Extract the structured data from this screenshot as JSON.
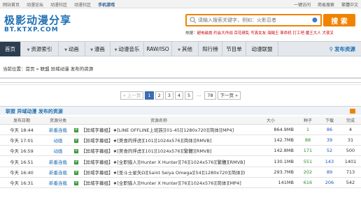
{
  "topbar": {
    "left_links": [
      "网站首页",
      "动漫论坛",
      "动漫社区",
      "动漫社区"
    ],
    "mobile": "手机游戏",
    "right_links": [
      "一键访问",
      "简易搜索",
      "繁體中文"
    ]
  },
  "brand": {
    "logo_cn": "极影动漫分享",
    "logo_en": "BT.KTXP.COM"
  },
  "search": {
    "placeholder": "请输入搜索关键字，例如：火影忍者",
    "button": "搜 索"
  },
  "hot": {
    "label": "热搜：",
    "keywords": "超电磁炮 约会大作战 百花缭乱 写真女友 海贼王 革命机 打工吧 魔王大人 犬夜叉"
  },
  "nav": {
    "items": [
      "首页",
      "资源索引",
      "动画",
      "漫画",
      "动漫音乐",
      "RAW/ISO",
      "其他",
      "阳行榜",
      "节目单",
      "动漫联盟"
    ],
    "publish": "发布资源"
  },
  "crumb": "当前位置：首页 » 联盟 异域动漫 发布的资源",
  "pager": {
    "prev": "« 上一页",
    "pages": [
      "1",
      "2",
      "3",
      "4",
      "5"
    ],
    "ellipsis": "...",
    "last": "78",
    "next": "下一页 »"
  },
  "list_title": "联盟 异域动漫 发布的资源",
  "table": {
    "headers": [
      "发布日期",
      "资源分类",
      "资源名称",
      "大小",
      "种子",
      "下载",
      "完成"
    ],
    "rows": [
      {
        "date": "今天 18:44",
        "cat": "新番连载",
        "name": "【异域字幕组】★[LINE OFFLINE上班族][01-45][1280x720][简体][MP4]",
        "size": "864.9MB",
        "seed": "1",
        "dl": "86",
        "done": "4"
      },
      {
        "date": "今天 17:01",
        "cat": "动画",
        "name": "【异域字幕组】★[美食的俘虏][101][1024x576][简体][RMVB]",
        "size": "142.7MB",
        "seed": "88",
        "dl": "39",
        "done": "31"
      },
      {
        "date": "今天 16:59",
        "cat": "动画",
        "name": "【异域字幕组】★[美食的俘虏][101][1024x576][繁體][RMVB]",
        "size": "142.8MB",
        "seed": "171",
        "dl": "52",
        "done": "500"
      },
      {
        "date": "今天 16:51",
        "cat": "新番连载",
        "name": "【异域字幕组】★[全职猎人][Hunter X Hunter][76][1024x576][繁體][RMVB]",
        "size": "130.1MB",
        "seed": "551",
        "dl": "143",
        "done": "1401"
      },
      {
        "date": "今天 16:40",
        "cat": "新番连载",
        "name": "【异域字幕组】★[圣斗士星矢Ω][Saint Seiya Omega][54][1280x720][简体][MP4]",
        "size": "293.7MB",
        "seed": "202",
        "dl": "89",
        "done": "713"
      },
      {
        "date": "今天 16:31",
        "cat": "新番连载",
        "name": "【异域字幕组】★[全职猎人][Hunter X Hunter][76][1024x576][简体][MP4]",
        "size": "141MB",
        "seed": "616",
        "dl": "206",
        "done": "542"
      }
    ]
  },
  "colors": {
    "brand_blue": "#1e6fb3",
    "search_orange": "#f08300",
    "nav_home_bg": "#2c3e50",
    "seed_green": "#2a8a2a",
    "download_blue": "#1e50c0"
  }
}
